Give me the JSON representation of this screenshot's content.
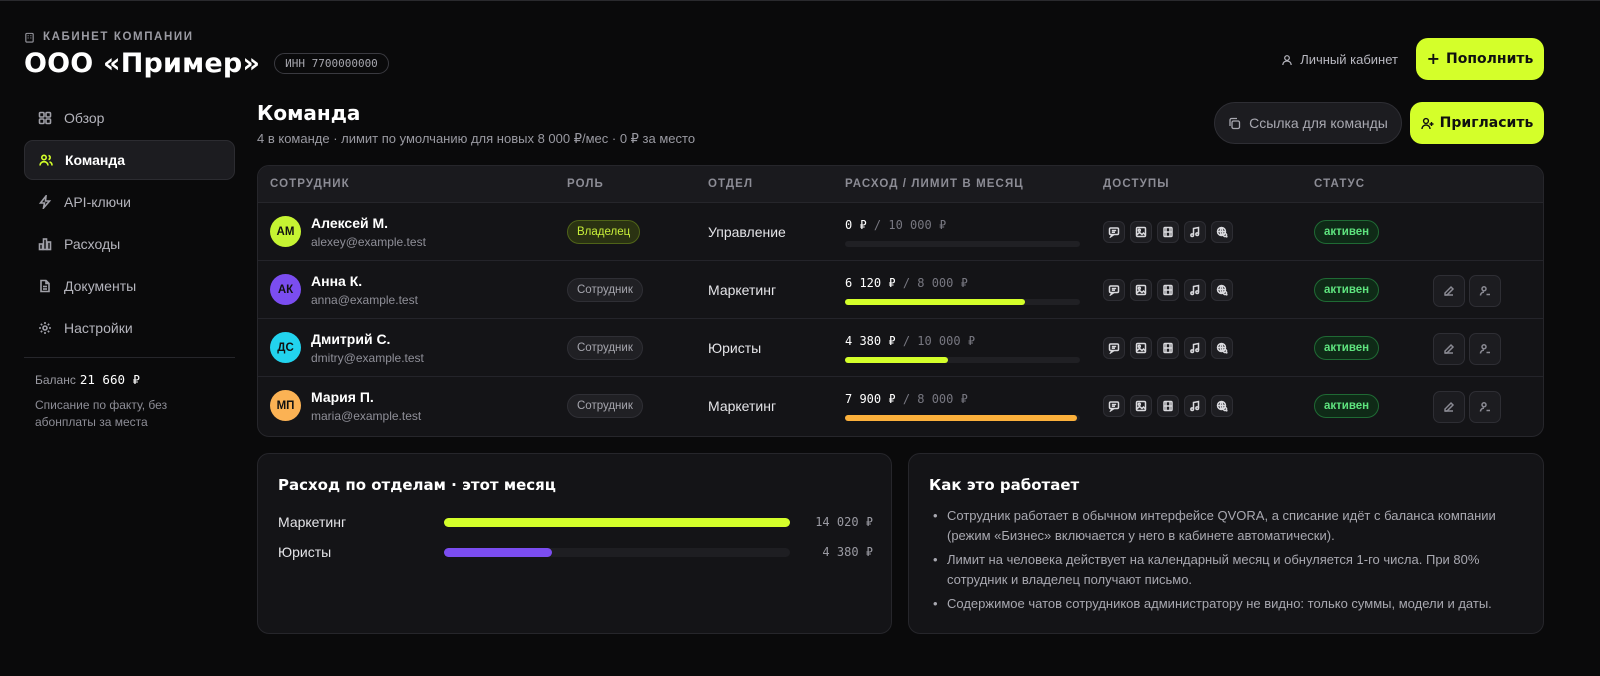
{
  "header": {
    "eyebrow": "КАБИНЕТ КОМПАНИИ",
    "company_name": "ООО «Пример»",
    "inn": "ИНН 7700000000",
    "personal_link": "Личный кабинет",
    "topup_label": "Пополнить"
  },
  "sidebar": {
    "items": [
      {
        "label": "Обзор",
        "icon": "grid-icon",
        "active": false
      },
      {
        "label": "Команда",
        "icon": "users-icon",
        "active": true
      },
      {
        "label": "API-ключи",
        "icon": "bolt-icon",
        "active": false
      },
      {
        "label": "Расходы",
        "icon": "bar-chart-icon",
        "active": false
      },
      {
        "label": "Документы",
        "icon": "document-icon",
        "active": false
      },
      {
        "label": "Настройки",
        "icon": "gear-icon",
        "active": false
      }
    ],
    "balance_label": "Баланс",
    "balance_value": "21 660 ₽",
    "note": "Списание по факту, без абонплаты за места"
  },
  "page": {
    "title": "Команда",
    "subtitle": "4 в команде · лимит по умолчанию для новых 8 000 ₽/мес · 0 ₽ за место",
    "link_button": "Ссылка для команды",
    "invite_button": "Пригласить"
  },
  "table": {
    "columns": [
      "СОТРУДНИК",
      "РОЛЬ",
      "ОТДЕЛ",
      "РАСХОД / ЛИМИТ В МЕСЯЦ",
      "ДОСТУПЫ",
      "СТАТУС"
    ],
    "rows": [
      {
        "initials": "АМ",
        "avatar_color": "#c6f432",
        "name": "Алексей М.",
        "email": "alexey@example.test",
        "role": "Владелец",
        "owner": true,
        "dept": "Управление",
        "spent": "0 ₽",
        "limit": "/ 10 000 ₽",
        "usage": 0.0,
        "bar_color": "#d4ff2a",
        "status": "активен",
        "actions": false
      },
      {
        "initials": "АК",
        "avatar_color": "#7b4df0",
        "name": "Анна К.",
        "email": "anna@example.test",
        "role": "Сотрудник",
        "owner": false,
        "dept": "Маркетинг",
        "spent": "6 120 ₽",
        "limit": "/ 8 000 ₽",
        "usage": 0.765,
        "bar_color": "#d4ff2a",
        "status": "активен",
        "actions": true
      },
      {
        "initials": "ДС",
        "avatar_color": "#22d3ee",
        "name": "Дмитрий С.",
        "email": "dmitry@example.test",
        "role": "Сотрудник",
        "owner": false,
        "dept": "Юристы",
        "spent": "4 380 ₽",
        "limit": "/ 10 000 ₽",
        "usage": 0.438,
        "bar_color": "#d4ff2a",
        "status": "активен",
        "actions": true
      },
      {
        "initials": "МП",
        "avatar_color": "#fbb254",
        "name": "Мария П.",
        "email": "maria@example.test",
        "role": "Сотрудник",
        "owner": false,
        "dept": "Маркетинг",
        "spent": "7 900 ₽",
        "limit": "/ 8 000 ₽",
        "usage": 0.9875,
        "bar_color": "#fbb03b",
        "status": "активен",
        "actions": true
      }
    ],
    "permission_icons": [
      "chat-icon",
      "image-icon",
      "video-icon",
      "music-icon",
      "web-search-icon"
    ]
  },
  "departments_card": {
    "title": "Расход по отделам · этот месяц",
    "rows": [
      {
        "label": "Маркетинг",
        "value": "14 020 ₽",
        "share": 1.0,
        "color": "#d4ff2a"
      },
      {
        "label": "Юристы",
        "value": "4 380 ₽",
        "share": 0.312,
        "color": "#7b4df0"
      }
    ]
  },
  "how_card": {
    "title": "Как это работает",
    "items": [
      "Сотрудник работает в обычном интерфейсе QVORA, а списание идёт с баланса компании (режим «Бизнес» включается у него в кабинете автоматически).",
      "Лимит на человека действует на календарный месяц и обнуляется 1-го числа. При 80% сотрудник и владелец получают письмо.",
      "Содержимое чатов сотрудников администратору не видно: только суммы, модели и даты."
    ]
  }
}
